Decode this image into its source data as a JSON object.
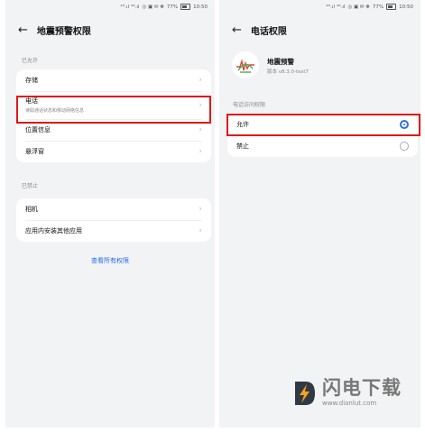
{
  "status_bar": {
    "signal": "⁴ᴳ.ıl ⁴ᴳ.ıl",
    "icons": "◎ ▣ ✉ ❋",
    "battery": "77%",
    "time": "10:50"
  },
  "left_screen": {
    "title": "地震预警权限",
    "allowed_header": "已允许",
    "allowed_items": [
      {
        "label": "存储",
        "sub": ""
      },
      {
        "label": "电话",
        "sub": "读取通话状态和移动网络信息"
      },
      {
        "label": "位置信息",
        "sub": ""
      },
      {
        "label": "悬浮窗",
        "sub": ""
      }
    ],
    "denied_header": "已禁止",
    "denied_items": [
      {
        "label": "相机"
      },
      {
        "label": "应用内安装其他应用"
      }
    ],
    "view_all_link": "查看所有权限"
  },
  "right_screen": {
    "title": "电话权限",
    "app_name": "地震预警",
    "app_version": "版本 v8.3.0-test7",
    "section_header": "电话访问权限",
    "options": [
      {
        "label": "允许",
        "selected": true
      },
      {
        "label": "禁止",
        "selected": false
      }
    ]
  },
  "watermark": {
    "brand": "闪电下载",
    "url": "www.dianlut.com"
  },
  "colors": {
    "accent": "#2a6ee8",
    "highlight": "#e01818",
    "background": "#f1f3f5"
  }
}
